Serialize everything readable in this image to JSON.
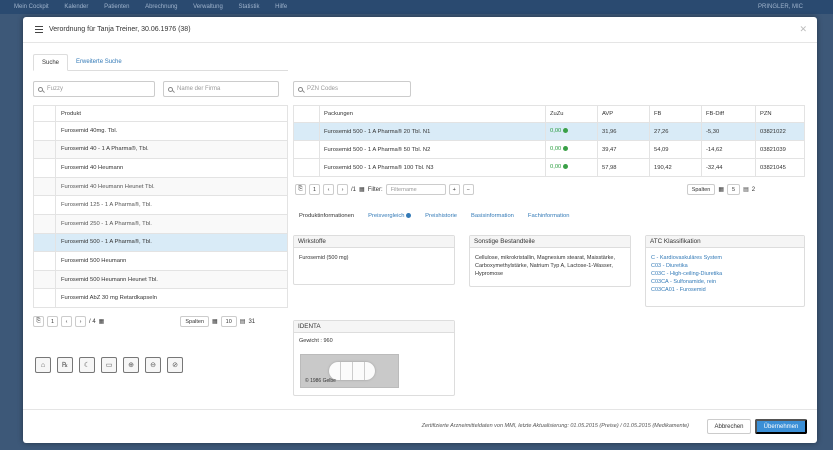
{
  "background": {
    "menu": [
      "Mein Cockpit",
      "Kalender",
      "Patienten",
      "Abrechnung",
      "Verwaltung",
      "Statistik",
      "Hilfe"
    ],
    "user": "PRINGLER, MIC"
  },
  "modal": {
    "title": "Verordnung für Tanja Treiner, 30.06.1976 (38)",
    "tabs": [
      "Suche",
      "Erweiterte Suche"
    ],
    "search_fuzzy_placeholder": "Fuzzy",
    "search_firm_placeholder": "Name der Firma",
    "search_pzn_placeholder": "PZN Codes",
    "products_header": "Produkt",
    "products": [
      "Furosemid 40mg. Tbl.",
      "Furosemid 40 - 1 A Pharma®, Tbl.",
      "Furosemid 40 Heumann",
      "Furosemid 40 Heumann Heunet Tbl.",
      "Furosemid 125 - 1 A Pharma®, Tbl.",
      "Furosemid 250 - 1 A Pharma®, Tbl.",
      "Furosemid 500 - 1 A Pharma®, Tbl.",
      "Furosemid 500 Heumann",
      "Furosemid 500 Heumann Heunet Tbl.",
      "Furosemid AbZ 30 mg Retardkapseln"
    ],
    "products_pager": {
      "page": "1",
      "of": "/ 4",
      "spalten": "Spalten",
      "per_page": "10",
      "count": "31"
    },
    "packages_headers": [
      "Packungen",
      "ZuZu",
      "AVP",
      "FB",
      "FB-Diff",
      "PZN"
    ],
    "packages": [
      {
        "name": "Furosemid 500 - 1 A Pharma® 20 Tbl. N1",
        "zuzu": "0,00",
        "avp": "31,96",
        "fb": "27,26",
        "fbdiff": "-5,30",
        "pzn": "03821022"
      },
      {
        "name": "Furosemid 500 - 1 A Pharma® 50 Tbl. N2",
        "zuzu": "0,00",
        "avp": "39,47",
        "fb": "54,09",
        "fbdiff": "-14,62",
        "pzn": "03821039"
      },
      {
        "name": "Furosemid 500 - 1 A Pharma® 100 Tbl. N3",
        "zuzu": "0,00",
        "avp": "57,98",
        "fb": "190,42",
        "fbdiff": "-32,44",
        "pzn": "03821045"
      }
    ],
    "packages_pager": {
      "page": "1",
      "of": "/1",
      "filter_label": "Filter:",
      "filter_value": "Filtername",
      "spalten": "Spalten",
      "per_page": "5",
      "count": "2"
    },
    "detail_tabs": [
      "Produktinformationen",
      "Preisvergleich",
      "Preishistorie",
      "Basisinformation",
      "Fachinformation"
    ],
    "wirkstoffe": {
      "title": "Wirkstoffe",
      "text": "Furosemid (500 mg)"
    },
    "sonstige": {
      "title": "Sonstige Bestandteile",
      "text": "Cellulose, mikrokristallin, Magnesium stearat, Maisstärke, Carboxymethylstärke, Natrium Typ A, Lactose-1-Wasser, Hypromose"
    },
    "atc": {
      "title": "ATC Klassifikation",
      "items": [
        "C - Kardiovaskuläres System",
        "C03 - Diuretika",
        "C03C - High-ceiling-Diuretika",
        "C03CA - Sulfonamide, rein",
        "C03CA01 - Furosemid"
      ]
    },
    "identa": {
      "title": "IDENTA",
      "weight": "Gewicht : 960",
      "caption": "© 1986 Gelbe"
    },
    "footer": {
      "note": "Zertifizierte Arzneimitteldaten von MMI, letzte Aktualisierung: 01.05.2015 (Preise) / 01.05.2015 (Medikamente)",
      "cancel": "Abbrechen",
      "ok": "Übernehmen"
    }
  },
  "icons": {
    "toolbar": [
      "home-icon",
      "rx-icon",
      "moon-icon",
      "car-icon",
      "plus-circle-icon",
      "minus-circle-icon",
      "ban-icon"
    ]
  }
}
